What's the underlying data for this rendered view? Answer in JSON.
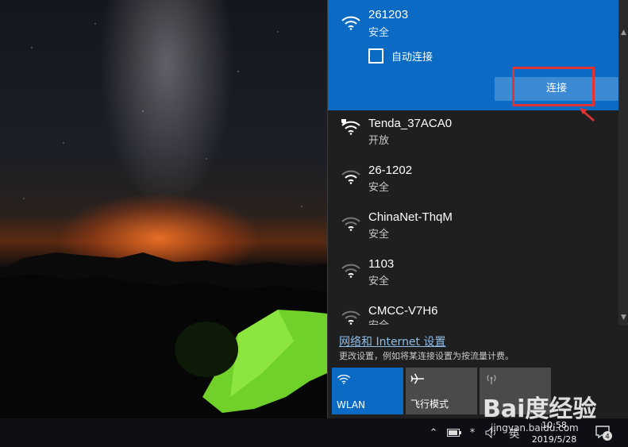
{
  "selected_network": {
    "name": "261203",
    "status": "安全",
    "auto_connect_label": "自动连接",
    "connect_label": "连接"
  },
  "networks": [
    {
      "name": "Tenda_37ACA0",
      "status": "开放",
      "icon": "wifi-open-icon"
    },
    {
      "name": "26-1202",
      "status": "安全",
      "icon": "wifi-icon"
    },
    {
      "name": "ChinaNet-ThqM",
      "status": "安全",
      "icon": "wifi-icon"
    },
    {
      "name": "1103",
      "status": "安全",
      "icon": "wifi-icon"
    },
    {
      "name": "CMCC-V7H6",
      "status": "安全",
      "icon": "wifi-icon"
    }
  ],
  "settings": {
    "link": "网络和 Internet 设置",
    "description": "更改设置，例如将某连接设置为按流量计费。"
  },
  "quick_actions": [
    {
      "label": "WLAN",
      "active": true,
      "icon": "wifi-icon"
    },
    {
      "label": "飞行模式",
      "active": false,
      "icon": "airplane-icon"
    },
    {
      "label": "",
      "active": false,
      "icon": "mobile-hotspot-icon"
    }
  ],
  "taskbar": {
    "ime": "英",
    "time": "10:58",
    "date": "2019/5/28",
    "notification_count": "4"
  },
  "watermark": {
    "logo": "Bai度经验",
    "url": "jingyan.baidu.com"
  },
  "colors": {
    "accent": "#0b6bc4",
    "highlight": "#e03434",
    "flyout_bg": "#1f1f1f"
  }
}
